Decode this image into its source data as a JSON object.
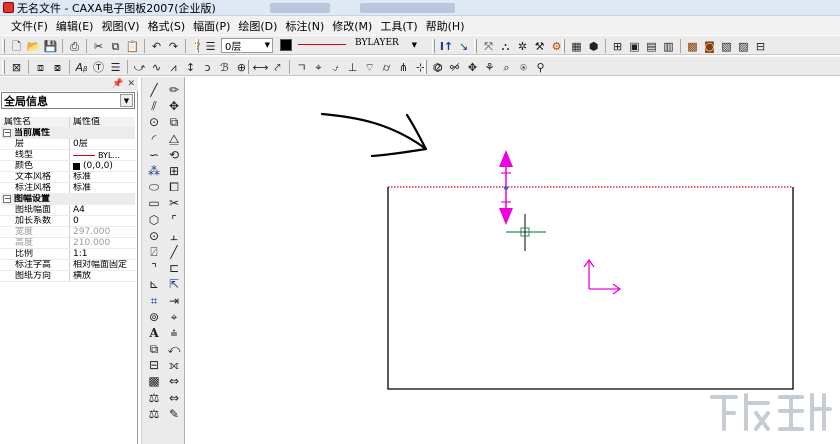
{
  "window": {
    "title": "无名文件 - CAXA电子图板2007(企业版)"
  },
  "menu": [
    {
      "label": "文件(F)"
    },
    {
      "label": "编辑(E)"
    },
    {
      "label": "视图(V)"
    },
    {
      "label": "格式(S)"
    },
    {
      "label": "幅面(P)"
    },
    {
      "label": "绘图(D)"
    },
    {
      "label": "标注(N)"
    },
    {
      "label": "修改(M)"
    },
    {
      "label": "工具(T)"
    },
    {
      "label": "帮助(H)"
    }
  ],
  "toolbar": {
    "layer_value": "0层",
    "color": "#000000",
    "linetype_color": "#d9001b",
    "linewidth_value": "BYLAYER"
  },
  "panel": {
    "scope_value": "全局信息",
    "header": {
      "name": "属性名",
      "value": "属性值"
    },
    "groups": [
      {
        "title": "当前属性",
        "rows": [
          {
            "name": "层",
            "value": "0层"
          },
          {
            "name": "线型",
            "value": "BYL..."
          },
          {
            "name": "颜色",
            "value": "(0,0,0)"
          },
          {
            "name": "文本风格",
            "value": "标准"
          },
          {
            "name": "标注风格",
            "value": "标准"
          }
        ]
      },
      {
        "title": "图幅设置",
        "rows": [
          {
            "name": "图纸幅面",
            "value": "A4"
          },
          {
            "name": "加长系数",
            "value": "0"
          },
          {
            "name": "宽度",
            "value": "297.000"
          },
          {
            "name": "高度",
            "value": "210.000"
          },
          {
            "name": "比例",
            "value": "1:1"
          },
          {
            "name": "标注字高",
            "value": "相对幅面固定"
          },
          {
            "name": "图纸方向",
            "value": "横放"
          }
        ]
      }
    ]
  },
  "canvas": {
    "accent_color": "#ee00dd",
    "paper_edge_color": "#d9001b",
    "crosshair_color": "#2e8b57"
  },
  "icons": {
    "toolbar_row1": [
      "new-file-icon",
      "open-file-icon",
      "save-icon",
      "print-icon",
      "cut-icon",
      "copy-icon",
      "paste-icon",
      "undo-icon",
      "redo-icon",
      "help-icon",
      "layer-icon",
      "color-icon",
      "linetype-icon",
      "linewidth-icon",
      "object-snap-icon",
      "snap-icon",
      "pan-icon",
      "zoom-icon",
      "dynamic-pan-icon",
      "zoom-window-icon",
      "redraw-icon",
      "library-icon",
      "insert-icon",
      "block-icon",
      "frame-icon",
      "title-block-icon",
      "parts-list-icon",
      "bom-icon",
      "balloon-icon",
      "drawing-frame-icon"
    ],
    "toolbar_row2": [
      "text-style-icon",
      "dimension-style-icon",
      "text-icon",
      "table-icon",
      "break-line-icon",
      "wave-line-icon",
      "hatch-icon",
      "center-line-icon",
      "spline-icon",
      "centerline-icon",
      "dim-linear-icon",
      "dim-align-icon",
      "coordinate-dim-icon",
      "leader-icon",
      "surface-symbol-icon",
      "datum-icon",
      "weld-icon",
      "tolerance-icon",
      "section-icon",
      "detail-view-icon",
      "dim-edit-icon",
      "zoom-all-icon",
      "zoom-in-icon",
      "zoom-out-icon",
      "zoom-extents-icon",
      "zoom-previous-icon"
    ],
    "vertical_col1": [
      "line-icon",
      "parallel-line-icon",
      "circle-icon",
      "arc-icon",
      "spline-icon",
      "point-icon",
      "ellipse-icon",
      "rectangle-icon",
      "polygon-icon",
      "centerline-icon",
      "hatch-icon",
      "equidistant-line-icon",
      "pattern-icon",
      "text-icon",
      "block-icon",
      "image-icon",
      "table-icon",
      "dimension-icon"
    ],
    "vertical_col2": [
      "erase-icon",
      "move-icon",
      "copy-icon",
      "mirror-icon",
      "rotate-icon",
      "array-icon",
      "scale-icon",
      "trim-icon",
      "extend-icon",
      "break-icon",
      "fillet-icon",
      "chamfer-icon",
      "stretch-icon",
      "explode-icon",
      "align-icon",
      "offset-icon",
      "lengthen-icon",
      "edit-icon"
    ]
  }
}
